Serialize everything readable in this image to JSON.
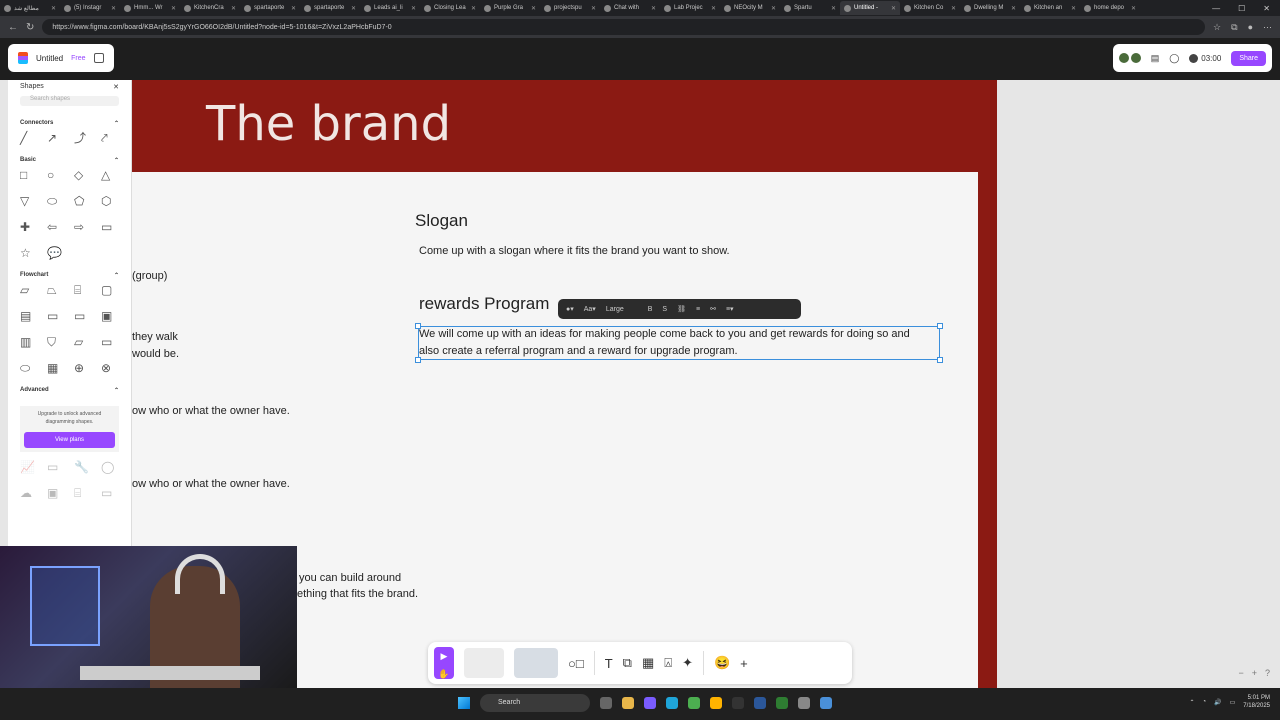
{
  "browser": {
    "tabs": [
      {
        "label": "مطالع شد"
      },
      {
        "label": "(5) Instagr"
      },
      {
        "label": "Hmm... Wr"
      },
      {
        "label": "KitchenCra"
      },
      {
        "label": "spartaporte"
      },
      {
        "label": "spartaporte"
      },
      {
        "label": "Leads ai_li"
      },
      {
        "label": "Closing Lea"
      },
      {
        "label": "Purple Gra"
      },
      {
        "label": "projectspu"
      },
      {
        "label": "Chat with"
      },
      {
        "label": "Lab Projec"
      },
      {
        "label": "NEOcity M"
      },
      {
        "label": "Spartu"
      },
      {
        "label": "Untitled -",
        "active": true
      },
      {
        "label": "Kitchen Co"
      },
      {
        "label": "Dwelling M"
      },
      {
        "label": "Kitchen an"
      },
      {
        "label": "home depo"
      }
    ],
    "url": "https://www.figma.com/board/KBAnj5sS2gyYrGO66OI2dB/Untitled?node-id=5-1016&t=ZiVxzL2aPHcbFuD7-0"
  },
  "figma": {
    "file_name": "Untitled",
    "plan": "Free",
    "timer": "03:00",
    "share_label": "Share"
  },
  "shapes_panel": {
    "title": "Shapes",
    "search_placeholder": "Search shapes",
    "sections": {
      "connectors": "Connectors",
      "basic": "Basic",
      "flowchart": "Flowchart",
      "advanced": "Advanced"
    },
    "upgrade_text": "Upgrade to unlock advanced diagramming shapes.",
    "view_plans": "View plans"
  },
  "board": {
    "title": "The brand",
    "slogan_heading": "Slogan",
    "slogan_text": "Come up with a slogan where it fits the brand you want to show.",
    "rewards_heading": "rewards Program",
    "rewards_line1": "We will come up with an ideas for making people come back to you and get rewards for doing so and",
    "rewards_line2": "also create a referral program and a reward for upgrade program.",
    "left_texts": [
      "(group)",
      "they walk",
      "would be.",
      "ow who or what the owner have.",
      "ow who or what the owner have.",
      "you can build around",
      "ething that fits the brand."
    ],
    "text_toolbar_size": "Large"
  },
  "taskbar": {
    "search": "Search",
    "time": "5:01 PM",
    "date": "7/18/2025"
  }
}
